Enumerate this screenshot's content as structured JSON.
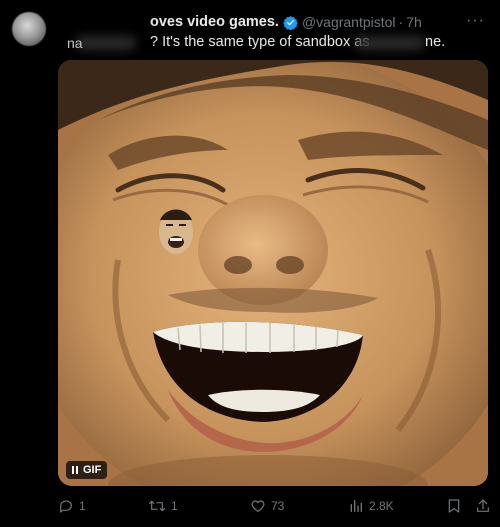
{
  "post": {
    "display_name": "oves video games.",
    "handle": "@vagrantpistol",
    "separator": "·",
    "time": "7h",
    "text_left_fragment": "na",
    "text": "? It's the same type of sandbox as",
    "text_tail": "ne.",
    "more_label": "···"
  },
  "media": {
    "badge_label": "GIF"
  },
  "actions": {
    "replies": "1",
    "reposts": "1",
    "likes": "73",
    "views": "2.8K"
  },
  "colors": {
    "background": "#000000",
    "text": "#e7e9ea",
    "muted": "#71767b",
    "verified": "#1d9bf0"
  }
}
